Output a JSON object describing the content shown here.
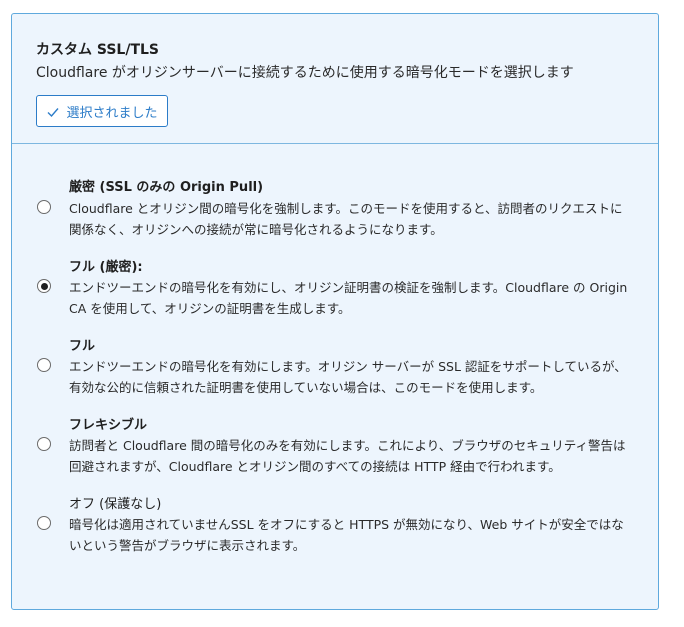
{
  "header": {
    "title": "カスタム SSL/TLS",
    "subtitle": "Cloudflare がオリジンサーバーに接続するために使用する暗号化モードを選択します",
    "selected_button_label": "選択されました"
  },
  "options": [
    {
      "title": "厳密 (SSL のみの Origin Pull)",
      "description": "Cloudflare とオリジン間の暗号化を強制します。このモードを使用すると、訪問者のリクエストに関係なく、オリジンへの接続が常に暗号化されるようになります。",
      "selected": false
    },
    {
      "title": "フル (厳密):",
      "description": "エンドツーエンドの暗号化を有効にし、オリジン証明書の検証を強制します。Cloudflare の Origin CA を使用して、オリジンの証明書を生成します。",
      "selected": true
    },
    {
      "title": "フル",
      "description": "エンドツーエンドの暗号化を有効にします。オリジン サーバーが SSL 認証をサポートしているが、有効な公的に信頼された証明書を使用していない場合は、このモードを使用します。",
      "selected": false
    },
    {
      "title": "フレキシブル",
      "description": "訪問者と Cloudflare 間の暗号化のみを有効にします。これにより、ブラウザのセキュリティ警告は回避されますが、Cloudflare とオリジン間のすべての接続は HTTP 経由で行われます。",
      "selected": false
    },
    {
      "title": "オフ (保護なし)",
      "description": "暗号化は適用されていませんSSL をオフにすると HTTPS が無効になり、Web サイトが安全ではないという警告がブラウザに表示されます。",
      "selected": false
    }
  ],
  "colors": {
    "card_background": "#edf5fd",
    "card_border": "#5fa9dd",
    "accent": "#2c7cc8"
  }
}
